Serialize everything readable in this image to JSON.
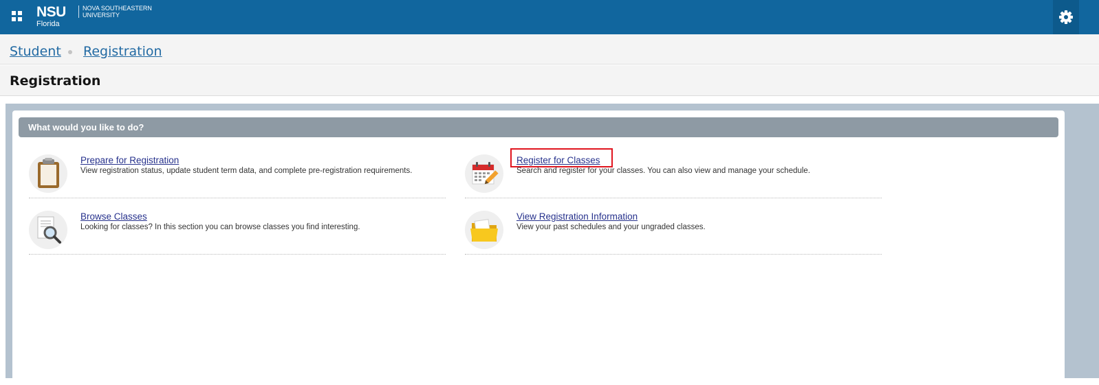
{
  "header": {
    "logo_main": "NSU",
    "logo_sub": "Florida",
    "logo_university": [
      "NOVA SOUTHEASTERN",
      "UNIVERSITY"
    ],
    "apps_icon": "grid-icon",
    "settings_icon": "gear-icon",
    "bar_color": "#11669e"
  },
  "breadcrumb": {
    "items": [
      "Student",
      "Registration"
    ]
  },
  "page": {
    "title": "Registration"
  },
  "panel": {
    "header": "What would you like to do?",
    "options": [
      {
        "label": "Prepare for Registration",
        "description": "View registration status, update student term data, and complete pre-registration requirements.",
        "icon": "clipboard-icon"
      },
      {
        "label": "Register for Classes",
        "description": "Search and register for your classes. You can also view and manage your schedule.",
        "icon": "calendar-icon",
        "highlighted": true
      },
      {
        "label": "Browse Classes",
        "description": "Looking for classes? In this section you can browse classes you find interesting.",
        "icon": "magnifier-document-icon"
      },
      {
        "label": "View Registration Information",
        "description": "View your past schedules and your ungraded classes.",
        "icon": "folder-icon"
      }
    ]
  }
}
